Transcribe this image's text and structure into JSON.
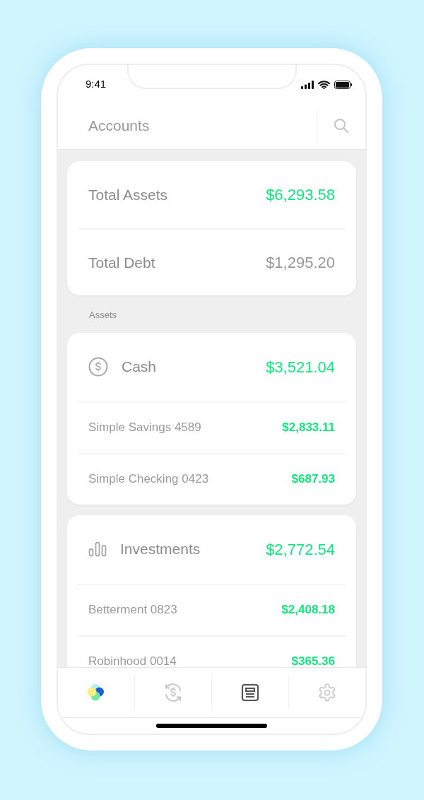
{
  "status_bar": {
    "time": "9:41"
  },
  "header": {
    "title": "Accounts"
  },
  "summary": [
    {
      "label": "Total Assets",
      "amount": "$6,293.58",
      "positive": true
    },
    {
      "label": "Total Debt",
      "amount": "$1,295.20",
      "positive": false
    }
  ],
  "section_label": "Assets",
  "groups": [
    {
      "kind": "cash",
      "name": "Cash",
      "total": "$3,521.04",
      "accounts": [
        {
          "name": "Simple Savings 4589",
          "amount": "$2,833.11"
        },
        {
          "name": "Simple Checking 0423",
          "amount": "$687.93"
        }
      ]
    },
    {
      "kind": "investments",
      "name": "Investments",
      "total": "$2,772.54",
      "accounts": [
        {
          "name": "Betterment 0823",
          "amount": "$2,408.18"
        },
        {
          "name": "Robinhood 0014",
          "amount": "$365.36"
        }
      ]
    }
  ],
  "tab_bar": [
    {
      "kind": "transactions",
      "selected": false
    },
    {
      "kind": "accounts",
      "selected": true
    },
    {
      "kind": "settings",
      "selected": false
    }
  ]
}
